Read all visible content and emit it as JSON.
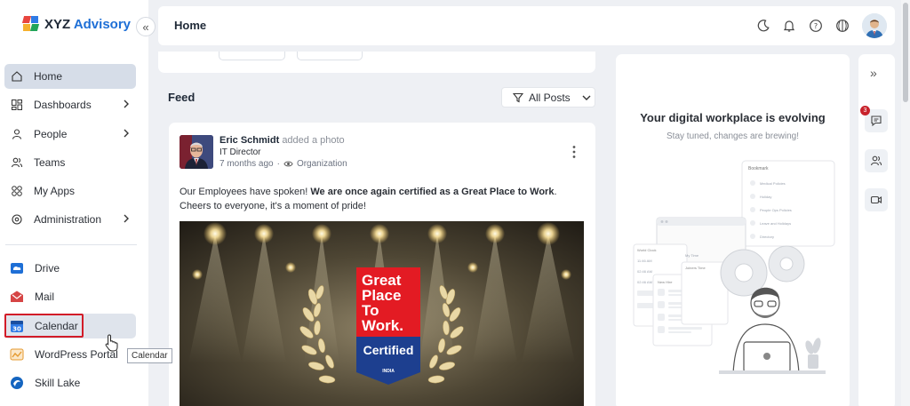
{
  "brand": {
    "name_part1": "XYZ",
    "name_part2": "Advisory",
    "logo_colors": [
      "#e8463f",
      "#2f7be6",
      "#f5b02e",
      "#22a55a"
    ]
  },
  "header": {
    "title": "Home",
    "icons": [
      "moon-icon",
      "bell-icon",
      "help-icon",
      "globe-icon"
    ]
  },
  "sidebar": {
    "nav": [
      {
        "label": "Home",
        "icon": "home-icon",
        "active": true,
        "has_children": false
      },
      {
        "label": "Dashboards",
        "icon": "dashboard-icon",
        "active": false,
        "has_children": true
      },
      {
        "label": "People",
        "icon": "person-icon",
        "active": false,
        "has_children": true
      },
      {
        "label": "Teams",
        "icon": "team-icon",
        "active": false,
        "has_children": false
      },
      {
        "label": "My Apps",
        "icon": "apps-icon",
        "active": false,
        "has_children": false
      },
      {
        "label": "Administration",
        "icon": "admin-icon",
        "active": false,
        "has_children": true
      }
    ],
    "apps": [
      {
        "label": "Drive",
        "icon": "drive-icon",
        "color": "#1e6fd6"
      },
      {
        "label": "Mail",
        "icon": "mail-icon",
        "color": "#d64545"
      },
      {
        "label": "Calendar",
        "icon": "calendar-icon",
        "color": "#2f7be6",
        "icon_text": "30"
      },
      {
        "label": "WordPress Portal",
        "icon": "wordpress-icon",
        "color": "#e59a2f"
      },
      {
        "label": "Skill Lake",
        "icon": "skill-lake-icon",
        "color": "#1565c0"
      }
    ],
    "tooltip": "Calendar"
  },
  "feed": {
    "label": "Feed",
    "filter_label": "All Posts",
    "post": {
      "author": "Eric Schmidt",
      "action": "added a photo",
      "role": "IT Director",
      "time": "7 months ago",
      "visibility": "Organization",
      "text_before": "Our Employees have spoken! ",
      "text_bold": "We are once again certified as a Great Place to Work",
      "text_after": ". Cheers to everyone, it's a moment of pride!",
      "badge": {
        "line1": "Great",
        "line2": "Place",
        "line3": "To",
        "line4": "Work.",
        "certified": "Certified",
        "country": "INDIA"
      }
    }
  },
  "promo": {
    "title": "Your digital workplace is evolving",
    "subtitle": "Stay tuned, changes are brewing!",
    "illustration": {
      "bookmark_title": "Bookmark",
      "bookmark_items": [
        "Medical Policies",
        "Holiday",
        "People Ops Policies",
        "Leave and Holidays",
        "Directory"
      ],
      "world_clock": "World Clock",
      "clock_times": [
        "11:46 AM",
        "02:46 AM",
        "02:46 AM"
      ],
      "my_time": "My Time",
      "new_hire": "New Hire",
      "joinees": "Joiners Time"
    }
  },
  "rail": {
    "notification_count": "3"
  }
}
